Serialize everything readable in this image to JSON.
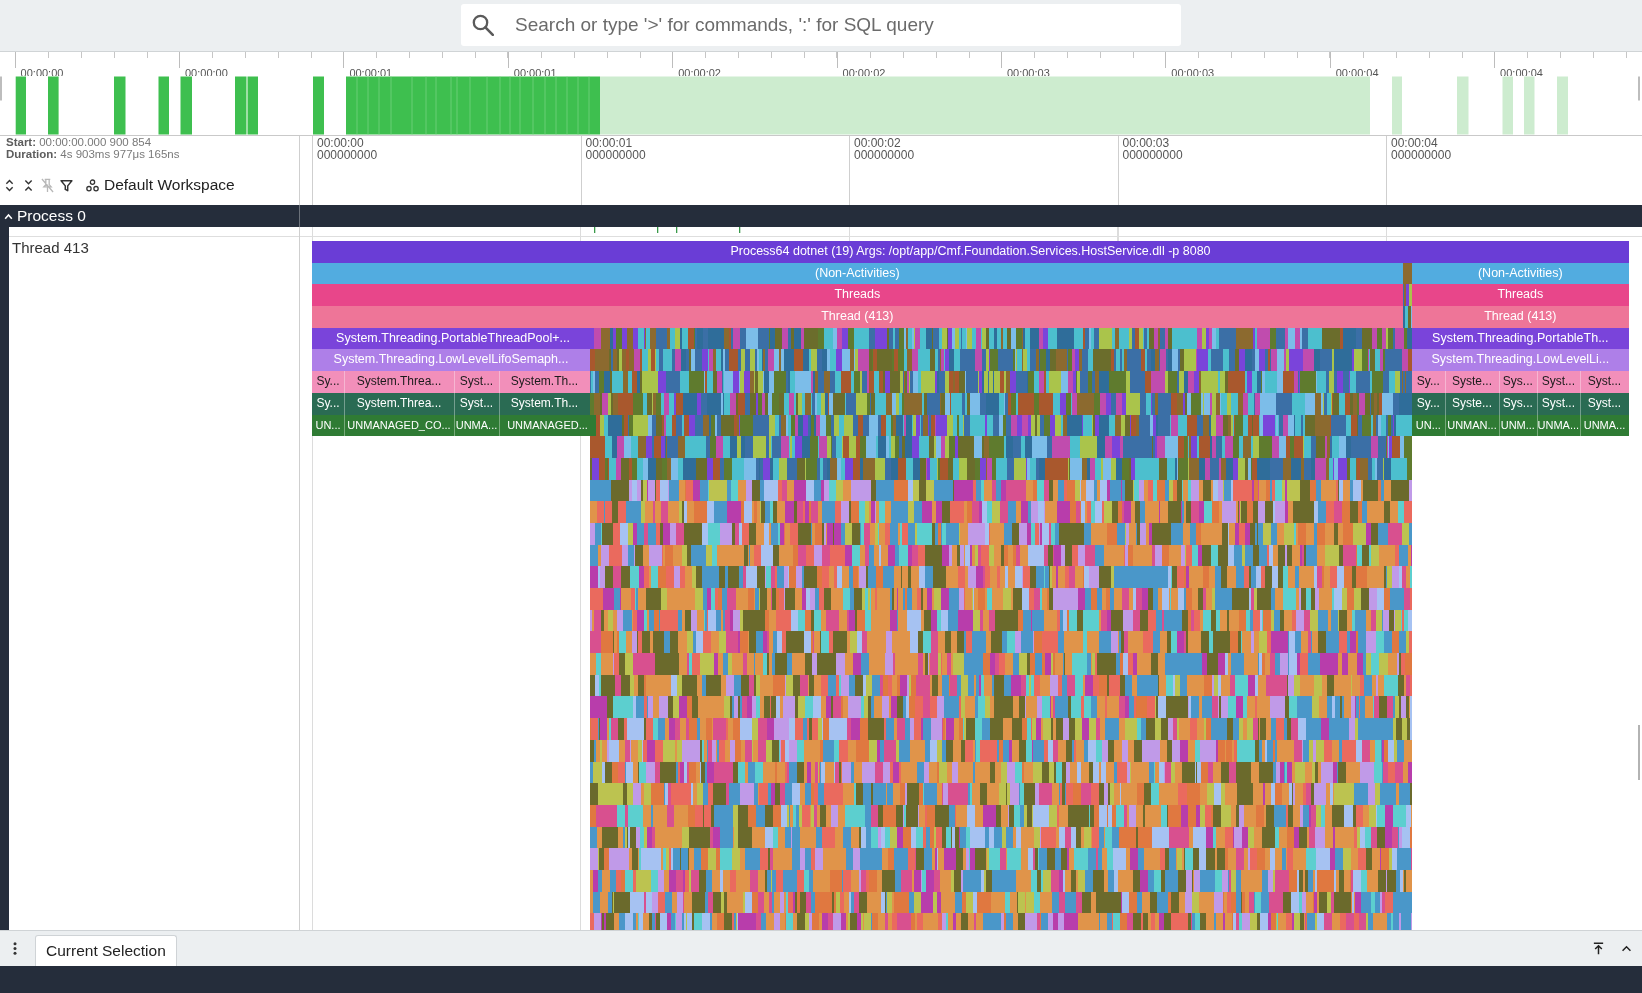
{
  "search": {
    "placeholder": "Search or type '>' for commands, ':' for SQL query"
  },
  "overview": {
    "tick_labels": [
      "00:00:00",
      "00:00:00",
      "00:00:01",
      "00:00:01",
      "00:00:02",
      "00:00:02",
      "00:00:03",
      "00:00:03",
      "00:00:04",
      "00:00:04"
    ]
  },
  "trace_info": {
    "start": "**Start:** 00:00:00.000 900 854",
    "duration": "**Duration:** 4s 903ms 977μs 165ns"
  },
  "track_tools": [
    {
      "kind": "expand",
      "disabled": false
    },
    {
      "kind": "collapse",
      "disabled": false
    },
    {
      "kind": "unpin",
      "disabled": true
    },
    {
      "kind": "filter",
      "disabled": false
    }
  ],
  "workspace": {
    "label": "Default Workspace"
  },
  "time_axis": {
    "ticks": [
      {
        "time": "00:00:00",
        "sub": "000000000"
      },
      {
        "time": "00:00:01",
        "sub": "000000000"
      },
      {
        "time": "00:00:02",
        "sub": "000000000"
      },
      {
        "time": "00:00:03",
        "sub": "000000000"
      },
      {
        "time": "00:00:04",
        "sub": "000000000"
      }
    ]
  },
  "process": {
    "name": "Process 0",
    "expanded": true
  },
  "thread": {
    "name": "Thread 413"
  },
  "flame_rows": [
    {
      "segments": [
        {
          "kind": "slice",
          "label": "Process64 dotnet (19) Args: /opt/app/Cmf.Foundation.Services.HostService.dll -p 8080",
          "color": "#6a3dd6"
        }
      ]
    },
    {
      "segments": [
        {
          "kind": "slice",
          "label": "(Non-Activities)",
          "color": "#52ace0"
        },
        {
          "kind": "dense"
        },
        {
          "kind": "slice",
          "label": "(Non-Activities)",
          "color": "#52ace0"
        }
      ]
    },
    {
      "segments": [
        {
          "kind": "slice",
          "label": "Threads",
          "color": "#e8468a"
        },
        {
          "kind": "dense"
        },
        {
          "kind": "slice",
          "label": "Threads",
          "color": "#e8468a"
        }
      ]
    },
    {
      "segments": [
        {
          "kind": "slice",
          "label": "Thread (413)",
          "color": "#ee7598"
        },
        {
          "kind": "dense"
        },
        {
          "kind": "slice",
          "label": "Thread (413)",
          "color": "#ee7598"
        }
      ]
    },
    {
      "segments": [
        {
          "kind": "slice",
          "label": "System.Threading.PortableThreadPool+...",
          "color": "#7a44da"
        },
        {
          "kind": "dense"
        },
        {
          "kind": "slice",
          "label": "System.Threading.PortableTh...",
          "color": "#7a44da"
        }
      ]
    },
    {
      "segments": [
        {
          "kind": "slice",
          "label": "System.Threading.LowLevelLifoSemaph...",
          "color": "#ae7fe8"
        },
        {
          "kind": "dense"
        },
        {
          "kind": "slice",
          "label": "System.Threading.LowLevelLi...",
          "color": "#ae7fe8"
        }
      ]
    },
    {
      "segments": [
        {
          "kind": "slice",
          "label": "Sy...",
          "color": "#f28fba"
        },
        {
          "kind": "slice",
          "label": "System.Threa...",
          "color": "#f28fba"
        },
        {
          "kind": "slice",
          "label": "Syst...",
          "color": "#f28fba"
        },
        {
          "kind": "slice",
          "label": "System.Th...",
          "color": "#f28fba"
        },
        {
          "kind": "dense"
        },
        {
          "kind": "slice",
          "label": "Sy...",
          "color": "#f28fba"
        },
        {
          "kind": "slice",
          "label": "Syste...",
          "color": "#f28fba"
        },
        {
          "kind": "slice",
          "label": "Sys...",
          "color": "#f28fba"
        },
        {
          "kind": "slice",
          "label": "Syst...",
          "color": "#f28fba"
        },
        {
          "kind": "slice",
          "label": "Syst...",
          "color": "#f28fba"
        }
      ]
    },
    {
      "segments": [
        {
          "kind": "slice",
          "label": "Sy...",
          "color": "#2a6b53"
        },
        {
          "kind": "slice",
          "label": "System.Threa...",
          "color": "#2a6b53"
        },
        {
          "kind": "slice",
          "label": "Syst...",
          "color": "#2a6b53"
        },
        {
          "kind": "slice",
          "label": "System.Th...",
          "color": "#2a6b53"
        },
        {
          "kind": "dense"
        },
        {
          "kind": "slice",
          "label": "Sy...",
          "color": "#2a6b53"
        },
        {
          "kind": "slice",
          "label": "Syste...",
          "color": "#2a6b53"
        },
        {
          "kind": "slice",
          "label": "Sys...",
          "color": "#2a6b53"
        },
        {
          "kind": "slice",
          "label": "Syst...",
          "color": "#2a6b53"
        },
        {
          "kind": "slice",
          "label": "Syst...",
          "color": "#2a6b53"
        }
      ]
    },
    {
      "segments": [
        {
          "kind": "slice",
          "label": "UN...",
          "color": "#2f7b34"
        },
        {
          "kind": "slice",
          "label": "UNMANAGED_CO...",
          "color": "#2f7b34"
        },
        {
          "kind": "slice",
          "label": "UNMA...",
          "color": "#2f7b34"
        },
        {
          "kind": "slice",
          "label": "UNMANAGED...",
          "color": "#2f7b34"
        },
        {
          "kind": "dense"
        },
        {
          "kind": "slice",
          "label": "UN...",
          "color": "#2f7b34"
        },
        {
          "kind": "slice",
          "label": "UNMAN...",
          "color": "#2f7b34"
        },
        {
          "kind": "slice",
          "label": "UNM...",
          "color": "#2f7b34"
        },
        {
          "kind": "slice",
          "label": "UNMA...",
          "color": "#2f7b34"
        },
        {
          "kind": "slice",
          "label": "UNMA...",
          "color": "#2f7b34"
        }
      ]
    }
  ],
  "bottom_panel": {
    "tabs": [
      {
        "label": "Current Selection",
        "selected": true
      }
    ]
  }
}
